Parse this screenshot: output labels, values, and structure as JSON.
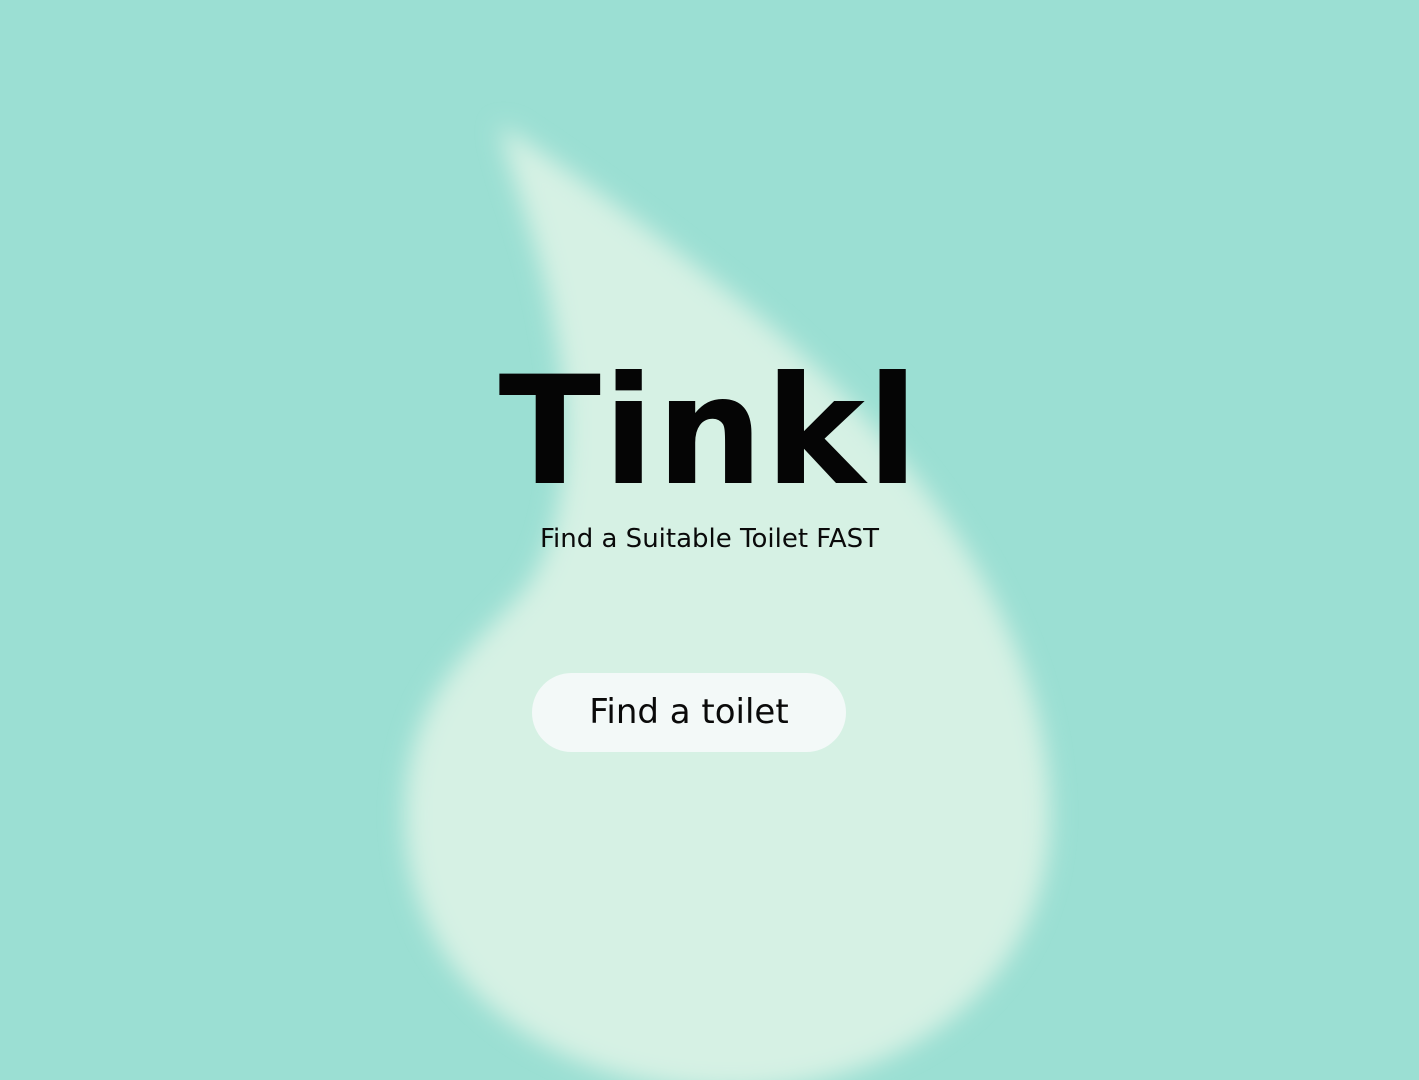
{
  "app": {
    "title": "Tinkl",
    "tagline": "Find a Suitable Toilet FAST"
  },
  "actions": {
    "find_toilet_label": "Find a toilet"
  },
  "colors": {
    "background": "#9bdfd3",
    "drop": "#d6f1e4",
    "button_bg": "#f3f9f8",
    "text": "#050505"
  },
  "decor": {
    "background_icon": "water-drop-icon"
  }
}
